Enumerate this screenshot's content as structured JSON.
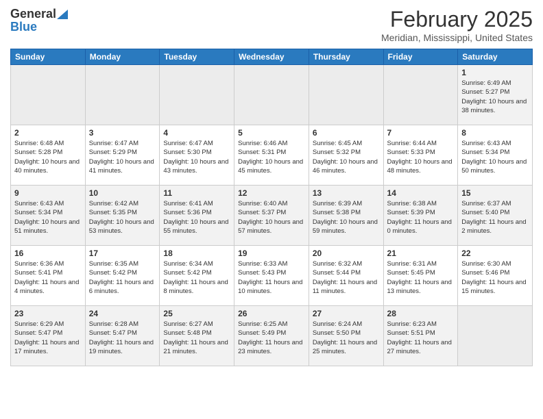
{
  "header": {
    "logo_line1": "General",
    "logo_line2": "Blue",
    "month": "February 2025",
    "location": "Meridian, Mississippi, United States"
  },
  "days_of_week": [
    "Sunday",
    "Monday",
    "Tuesday",
    "Wednesday",
    "Thursday",
    "Friday",
    "Saturday"
  ],
  "weeks": [
    [
      {
        "day": "",
        "info": ""
      },
      {
        "day": "",
        "info": ""
      },
      {
        "day": "",
        "info": ""
      },
      {
        "day": "",
        "info": ""
      },
      {
        "day": "",
        "info": ""
      },
      {
        "day": "",
        "info": ""
      },
      {
        "day": "1",
        "info": "Sunrise: 6:49 AM\nSunset: 5:27 PM\nDaylight: 10 hours\nand 38 minutes."
      }
    ],
    [
      {
        "day": "2",
        "info": "Sunrise: 6:48 AM\nSunset: 5:28 PM\nDaylight: 10 hours\nand 40 minutes."
      },
      {
        "day": "3",
        "info": "Sunrise: 6:47 AM\nSunset: 5:29 PM\nDaylight: 10 hours\nand 41 minutes."
      },
      {
        "day": "4",
        "info": "Sunrise: 6:47 AM\nSunset: 5:30 PM\nDaylight: 10 hours\nand 43 minutes."
      },
      {
        "day": "5",
        "info": "Sunrise: 6:46 AM\nSunset: 5:31 PM\nDaylight: 10 hours\nand 45 minutes."
      },
      {
        "day": "6",
        "info": "Sunrise: 6:45 AM\nSunset: 5:32 PM\nDaylight: 10 hours\nand 46 minutes."
      },
      {
        "day": "7",
        "info": "Sunrise: 6:44 AM\nSunset: 5:33 PM\nDaylight: 10 hours\nand 48 minutes."
      },
      {
        "day": "8",
        "info": "Sunrise: 6:43 AM\nSunset: 5:34 PM\nDaylight: 10 hours\nand 50 minutes."
      }
    ],
    [
      {
        "day": "9",
        "info": "Sunrise: 6:43 AM\nSunset: 5:34 PM\nDaylight: 10 hours\nand 51 minutes."
      },
      {
        "day": "10",
        "info": "Sunrise: 6:42 AM\nSunset: 5:35 PM\nDaylight: 10 hours\nand 53 minutes."
      },
      {
        "day": "11",
        "info": "Sunrise: 6:41 AM\nSunset: 5:36 PM\nDaylight: 10 hours\nand 55 minutes."
      },
      {
        "day": "12",
        "info": "Sunrise: 6:40 AM\nSunset: 5:37 PM\nDaylight: 10 hours\nand 57 minutes."
      },
      {
        "day": "13",
        "info": "Sunrise: 6:39 AM\nSunset: 5:38 PM\nDaylight: 10 hours\nand 59 minutes."
      },
      {
        "day": "14",
        "info": "Sunrise: 6:38 AM\nSunset: 5:39 PM\nDaylight: 11 hours\nand 0 minutes."
      },
      {
        "day": "15",
        "info": "Sunrise: 6:37 AM\nSunset: 5:40 PM\nDaylight: 11 hours\nand 2 minutes."
      }
    ],
    [
      {
        "day": "16",
        "info": "Sunrise: 6:36 AM\nSunset: 5:41 PM\nDaylight: 11 hours\nand 4 minutes."
      },
      {
        "day": "17",
        "info": "Sunrise: 6:35 AM\nSunset: 5:42 PM\nDaylight: 11 hours\nand 6 minutes."
      },
      {
        "day": "18",
        "info": "Sunrise: 6:34 AM\nSunset: 5:42 PM\nDaylight: 11 hours\nand 8 minutes."
      },
      {
        "day": "19",
        "info": "Sunrise: 6:33 AM\nSunset: 5:43 PM\nDaylight: 11 hours\nand 10 minutes."
      },
      {
        "day": "20",
        "info": "Sunrise: 6:32 AM\nSunset: 5:44 PM\nDaylight: 11 hours\nand 11 minutes."
      },
      {
        "day": "21",
        "info": "Sunrise: 6:31 AM\nSunset: 5:45 PM\nDaylight: 11 hours\nand 13 minutes."
      },
      {
        "day": "22",
        "info": "Sunrise: 6:30 AM\nSunset: 5:46 PM\nDaylight: 11 hours\nand 15 minutes."
      }
    ],
    [
      {
        "day": "23",
        "info": "Sunrise: 6:29 AM\nSunset: 5:47 PM\nDaylight: 11 hours\nand 17 minutes."
      },
      {
        "day": "24",
        "info": "Sunrise: 6:28 AM\nSunset: 5:47 PM\nDaylight: 11 hours\nand 19 minutes."
      },
      {
        "day": "25",
        "info": "Sunrise: 6:27 AM\nSunset: 5:48 PM\nDaylight: 11 hours\nand 21 minutes."
      },
      {
        "day": "26",
        "info": "Sunrise: 6:25 AM\nSunset: 5:49 PM\nDaylight: 11 hours\nand 23 minutes."
      },
      {
        "day": "27",
        "info": "Sunrise: 6:24 AM\nSunset: 5:50 PM\nDaylight: 11 hours\nand 25 minutes."
      },
      {
        "day": "28",
        "info": "Sunrise: 6:23 AM\nSunset: 5:51 PM\nDaylight: 11 hours\nand 27 minutes."
      },
      {
        "day": "",
        "info": ""
      }
    ]
  ]
}
